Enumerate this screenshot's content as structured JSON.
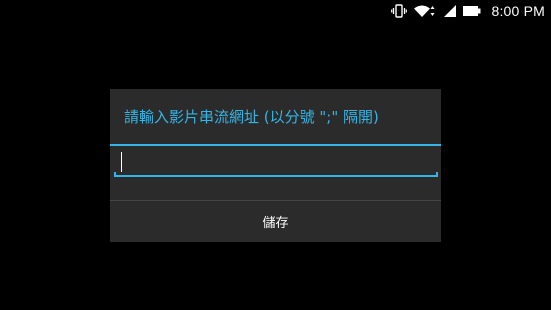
{
  "status_bar": {
    "time": "8:00 PM",
    "icons": [
      "vibrate-icon",
      "wifi-icon",
      "cell-signal-icon",
      "battery-icon"
    ]
  },
  "dialog": {
    "title": "請輸入影片串流網址 (以分號 \";\" 隔開)",
    "input": {
      "value": "",
      "placeholder": ""
    },
    "save_label": "儲存"
  },
  "colors": {
    "background": "#000000",
    "dialog_background": "#2b2b2b",
    "accent": "#33b5e5",
    "text": "#ffffff"
  }
}
